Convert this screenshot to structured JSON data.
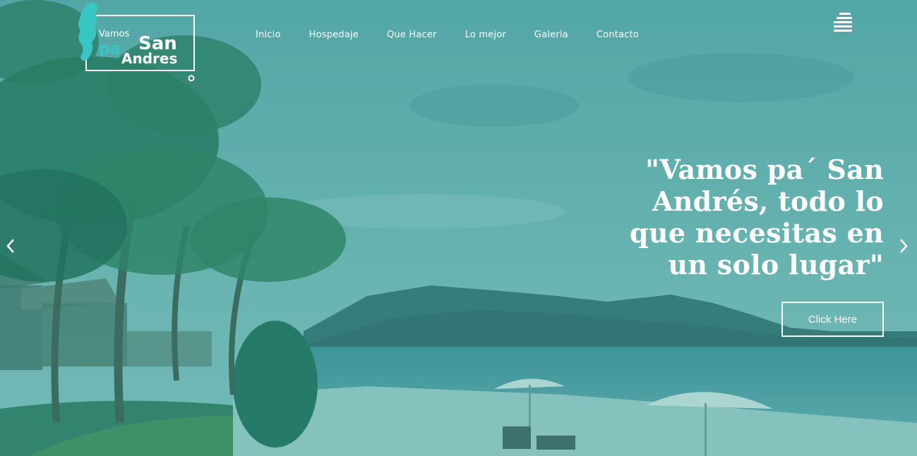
{
  "logo": {
    "line1": "Vamos",
    "line2": "pa",
    "line3": "San",
    "line4": "Andres",
    "icon": "seahorse-icon"
  },
  "nav": {
    "items": [
      "Inicio",
      "Hospedaje",
      "Que Hacer",
      "Lo mejor",
      "Galeria",
      "Contacto"
    ]
  },
  "menu": {
    "icon": "hamburger-menu-icon"
  },
  "hero": {
    "headline": "\"Vamos pa´ San Andrés, todo lo que necesitas en un solo lugar\"",
    "cta_label": "Click Here",
    "prev_icon": "chevron-left-icon",
    "next_icon": "chevron-right-icon"
  },
  "colors": {
    "overlay": "#5faead",
    "accent": "#37c6c4",
    "text": "#ffffff"
  }
}
